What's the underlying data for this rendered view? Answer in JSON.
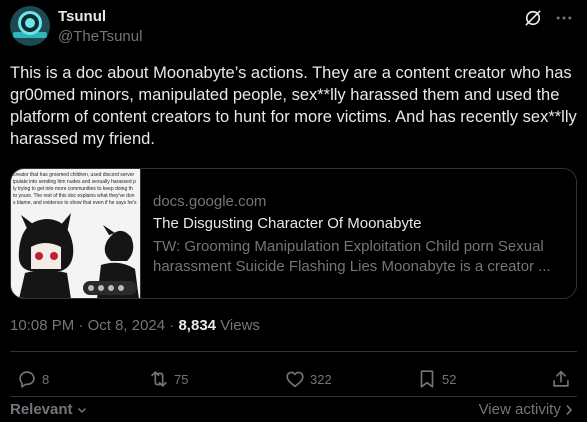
{
  "author": {
    "name": "Tsunul",
    "handle": "@TheTsunul"
  },
  "tweet": {
    "text": "This is a doc about Moonabyte’s actions. They are a content creator who has gr00med minors, manipulated people, sex**lly harassed them and used the platform of content creators to hunt for more victims. And has recently sex**lly harassed my friend."
  },
  "link_card": {
    "domain": "docs.google.com",
    "title": "The Disgusting Character Of Moonabyte",
    "description": "TW: Grooming Manipulation Exploitation Child porn Sexual harassment Suicide Flashing Lies Moonabyte is a creator ...",
    "thumbnail_lines": [
      "creator that has groomed children, used discord server",
      "ipulate into sending him nudes and sexually harassed p",
      "ly trying to get into more communities to keep doing th",
      "to yours. The rest of this doc explains what they've don",
      "s blame, and evidence to show that even if he says he's"
    ]
  },
  "meta": {
    "time": "10:08 PM",
    "date": "Oct 8, 2024",
    "separator": " · ",
    "views_count": "8,834",
    "views_label": "Views"
  },
  "actions": {
    "replies": "8",
    "reposts": "75",
    "likes": "322",
    "bookmarks": "52"
  },
  "footer": {
    "sort_label": "Relevant",
    "view_activity": "View activity"
  },
  "colors": {
    "background": "#000000",
    "text": "#e7e9ea",
    "muted": "#71767b",
    "border": "#2f3336"
  }
}
